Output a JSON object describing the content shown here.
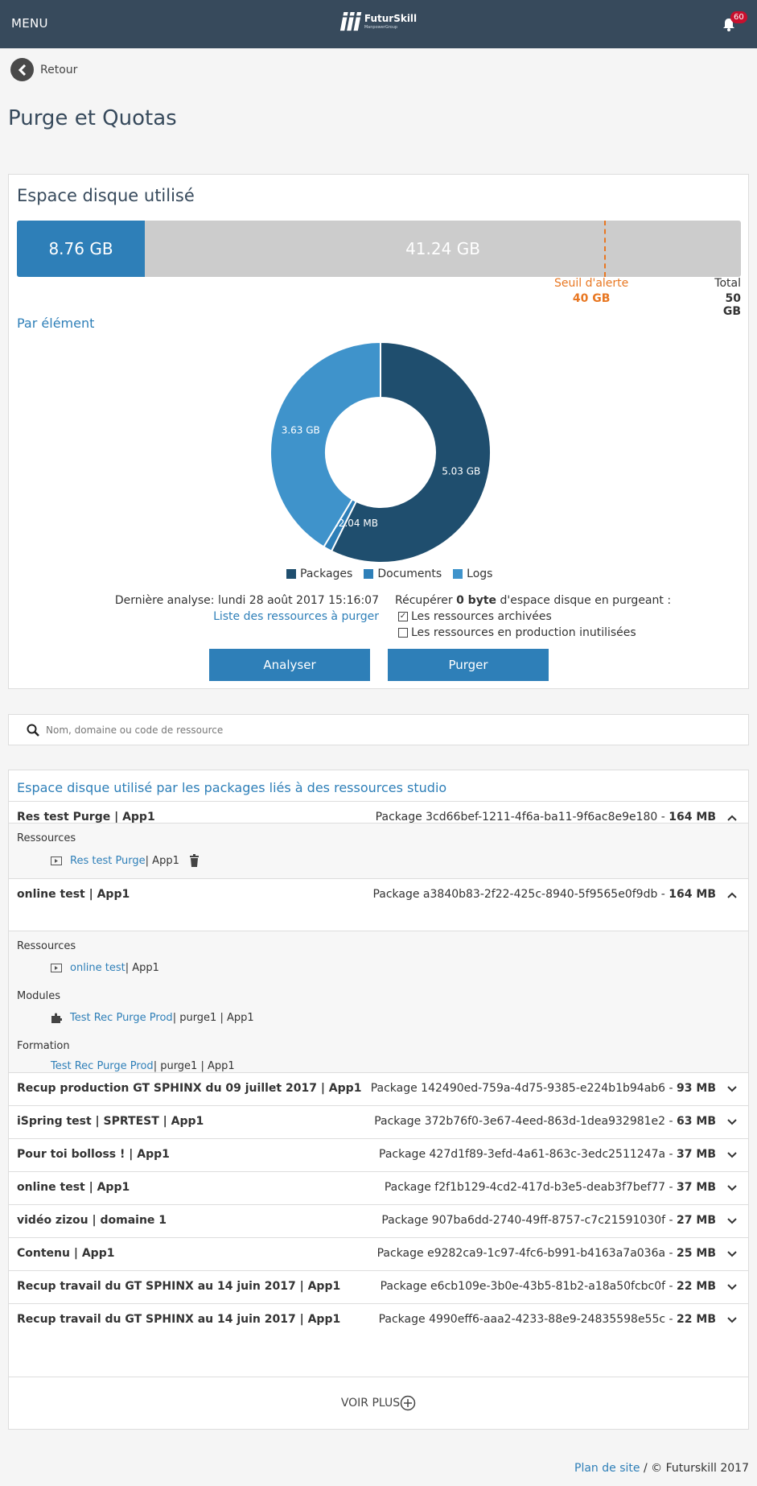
{
  "header": {
    "menu_label": "MENU",
    "logo_name": "FuturSkill",
    "logo_sub": "ManpowerGroup",
    "notification_count": "60"
  },
  "back_label": "Retour",
  "page_title": "Purge et Quotas",
  "disk": {
    "title": "Espace disque utilisé",
    "used_label": "8.76 GB",
    "free_label": "41.24 GB",
    "used_gb": 8.76,
    "threshold_gb": 40,
    "total_gb": 50,
    "threshold_label": "Seuil d'alerte",
    "threshold_value": "40 GB",
    "total_label": "Total",
    "total_value": "50 GB"
  },
  "par_element": "Par élément",
  "chart_data": {
    "type": "pie",
    "donut": true,
    "categories": [
      "Packages",
      "Documents",
      "Logs"
    ],
    "values_gb": [
      5.03,
      0.11204,
      3.63
    ],
    "labels": [
      "5.03 GB",
      "112.04 MB",
      "3.63 GB"
    ],
    "colors": [
      "#1f4e6e",
      "#2e7fb8",
      "#3f93cb"
    ],
    "legend_position": "bottom"
  },
  "analysis": {
    "last_label": "Dernière analyse: lundi 28 août 2017 15:16:07",
    "list_link": "Liste des ressources à purger",
    "recover_prefix": "Récupérer ",
    "recover_bold": "0 byte",
    "recover_suffix": " d'espace disque en purgeant :",
    "opt_archived": "Les ressources archivées",
    "opt_archived_checked": true,
    "opt_unused": "Les ressources en production inutilisées",
    "opt_unused_checked": false,
    "analyse_btn": "Analyser",
    "purge_btn": "Purger"
  },
  "search": {
    "placeholder": "Nom, domaine ou code de ressource"
  },
  "packages": {
    "title": "Espace disque utilisé par les packages liés à des ressources studio",
    "rows": [
      {
        "name": "Res test Purge | App1",
        "pkg": "Package 3cd66bef-1211-4f6a-ba11-9f6ac8e9e180 - ",
        "size": "164 MB",
        "expanded": true
      },
      {
        "name": "online test | App1",
        "pkg": "Package a3840b83-2f22-425c-8940-5f9565e0f9db - ",
        "size": "164 MB",
        "expanded": true
      },
      {
        "name": "Recup production GT SPHINX du 09 juillet 2017 | App1",
        "pkg": "Package 142490ed-759a-4d75-9385-e224b1b94ab6 - ",
        "size": "93 MB",
        "expanded": false
      },
      {
        "name": "iSpring test | SPRTEST | App1",
        "pkg": "Package 372b76f0-3e67-4eed-863d-1dea932981e2 - ",
        "size": "63 MB",
        "expanded": false
      },
      {
        "name": "Pour toi bolloss ! | App1",
        "pkg": "Package 427d1f89-3efd-4a61-863c-3edc2511247a - ",
        "size": "37 MB",
        "expanded": false
      },
      {
        "name": "online test | App1",
        "pkg": "Package f2f1b129-4cd2-417d-b3e5-deab3f7bef77 - ",
        "size": "37 MB",
        "expanded": false
      },
      {
        "name": "vidéo zizou | domaine 1",
        "pkg": "Package 907ba6dd-2740-49ff-8757-c7c21591030f - ",
        "size": "27 MB",
        "expanded": false
      },
      {
        "name": "Contenu | App1",
        "pkg": "Package e9282ca9-1c97-4fc6-b991-b4163a7a036a - ",
        "size": "25 MB",
        "expanded": false
      },
      {
        "name": "Recup travail du GT SPHINX au 14 juin 2017 | App1",
        "pkg": "Package e6cb109e-3b0e-43b5-81b2-a18a50fcbc0f - ",
        "size": "22 MB",
        "expanded": false
      },
      {
        "name": "Recup travail du GT SPHINX au 14 juin 2017 | App1",
        "pkg": "Package 4990eff6-aaa2-4233-88e9-24835598e55c - ",
        "size": "22 MB",
        "expanded": false
      }
    ],
    "detail1": {
      "res_label": "Ressources",
      "res_link": "Res test Purge",
      "res_suffix": " | App1"
    },
    "detail2": {
      "res_label": "Ressources",
      "res_link": "online test",
      "res_suffix": " | App1",
      "mod_label": "Modules",
      "mod_link": "Test Rec Purge Prod",
      "mod_suffix": " | purge1 | App1",
      "form_label": "Formation",
      "form_link": "Test Rec Purge Prod",
      "form_suffix": " | purge1 | App1"
    },
    "voir_plus": "VOIR PLUS"
  },
  "footer": {
    "plan_link": "Plan de site",
    "copyright": " / © Futurskill 2017"
  }
}
